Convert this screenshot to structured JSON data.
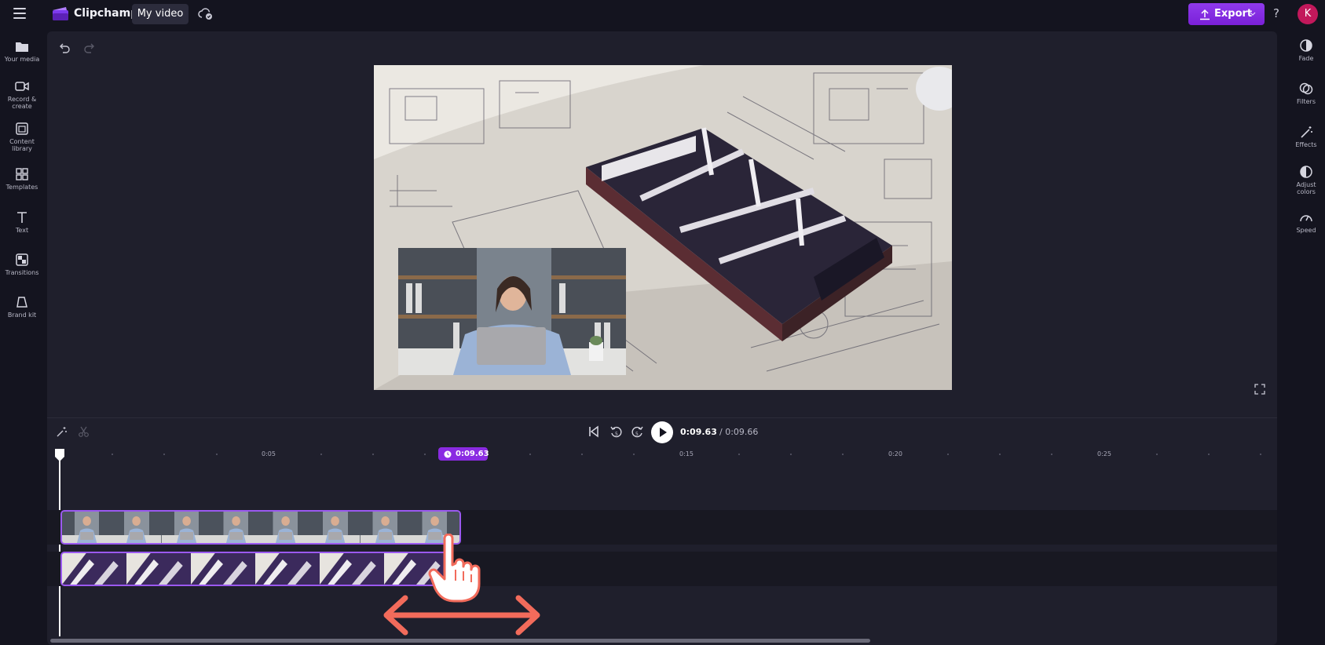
{
  "app": {
    "brand": "Clipchamp",
    "project_title": "My video",
    "export_label": "Export",
    "help_label": "?",
    "avatar_initial": "K"
  },
  "left_sidebar": [
    {
      "label": "Your media",
      "icon": "folder-icon"
    },
    {
      "label": "Record & create",
      "icon": "camera-icon"
    },
    {
      "label": "Content library",
      "icon": "library-icon"
    },
    {
      "label": "Templates",
      "icon": "templates-icon"
    },
    {
      "label": "Text",
      "icon": "text-icon"
    },
    {
      "label": "Transitions",
      "icon": "transitions-icon"
    },
    {
      "label": "Brand kit",
      "icon": "brand-kit-icon"
    }
  ],
  "right_sidebar": [
    {
      "label": "Fade",
      "icon": "fade-icon"
    },
    {
      "label": "Filters",
      "icon": "filters-icon"
    },
    {
      "label": "Effects",
      "icon": "effects-icon"
    },
    {
      "label": "Adjust colors",
      "icon": "adjust-colors-icon"
    },
    {
      "label": "Speed",
      "icon": "speed-icon"
    }
  ],
  "playback": {
    "current_time": "0:09.63",
    "total_time": "/ 0:09.66"
  },
  "timeline": {
    "playhead_time": "0:09.63",
    "ticks": [
      "0:05",
      "0:15",
      "0:20",
      "0:25"
    ],
    "tracks": [
      {
        "name": "Presenter video clip",
        "frames": 8
      },
      {
        "name": "Blueprint video clip",
        "frames": 6
      }
    ]
  },
  "colors": {
    "accent": "#8a2be2",
    "background": "#14141f",
    "panel": "#1f1f2c",
    "avatar": "#c2185b",
    "drag_arrow": "#f26b5b"
  }
}
